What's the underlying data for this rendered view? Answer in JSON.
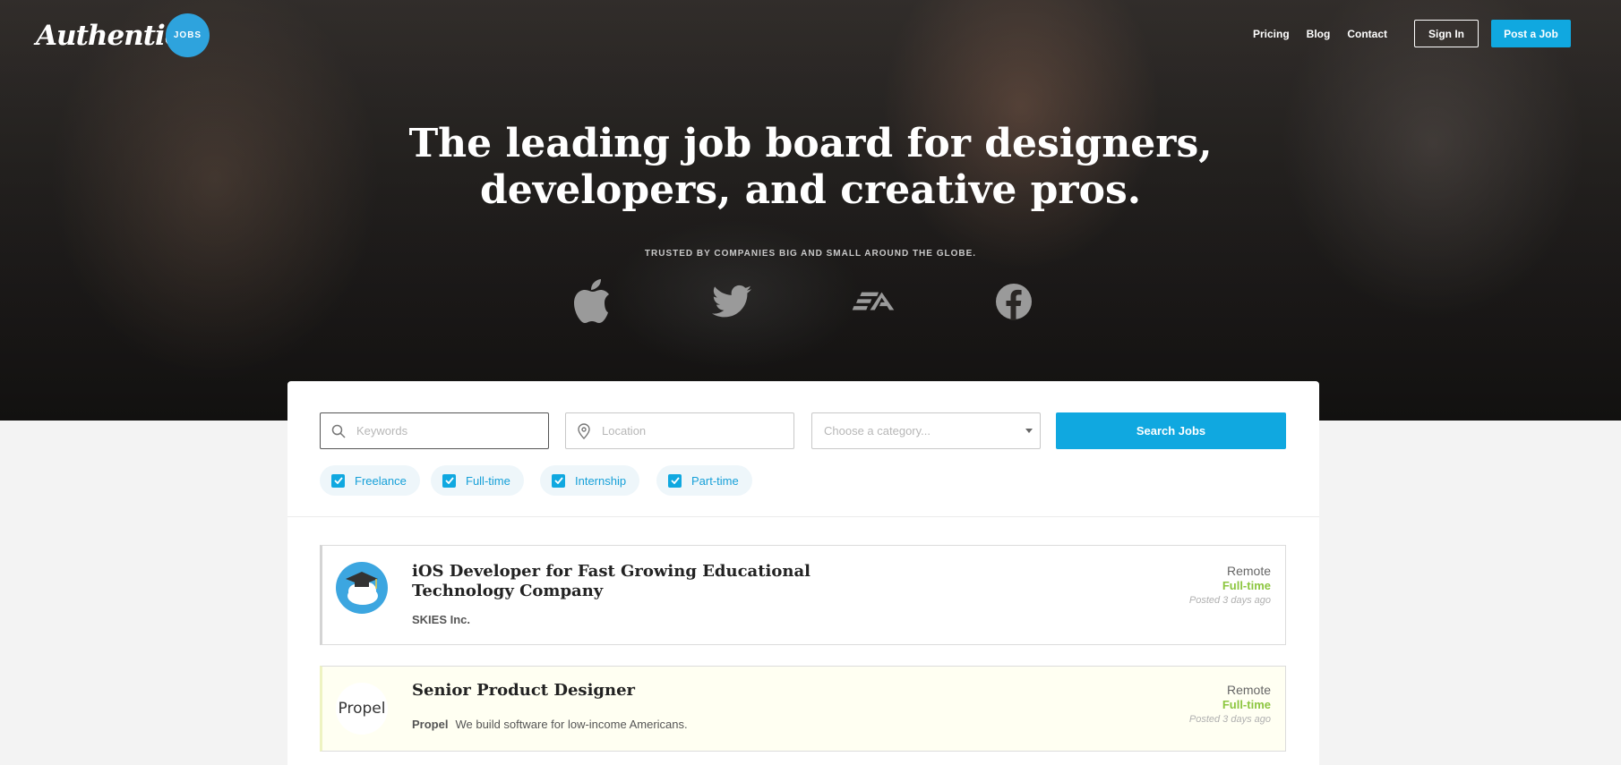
{
  "brand": {
    "logo_text": "Authentic",
    "badge": "JOBS"
  },
  "nav": {
    "links": [
      "Pricing",
      "Blog",
      "Contact"
    ],
    "sign_in": "Sign In",
    "post_job": "Post a Job"
  },
  "hero": {
    "headline_line1": "The leading job board for designers,",
    "headline_line2": "developers, and creative pros.",
    "trusted": "TRUSTED BY COMPANIES BIG AND SMALL AROUND THE GLOBE.",
    "brands": [
      "apple-icon",
      "twitter-icon",
      "ea-icon",
      "facebook-icon"
    ]
  },
  "search": {
    "keywords_placeholder": "Keywords",
    "location_placeholder": "Location",
    "category_placeholder": "Choose a category...",
    "button": "Search Jobs",
    "filters": [
      {
        "label": "Freelance",
        "checked": true
      },
      {
        "label": "Full-time",
        "checked": true
      },
      {
        "label": "Internship",
        "checked": true
      },
      {
        "label": "Part-time",
        "checked": true
      }
    ]
  },
  "jobs": [
    {
      "title": "iOS Developer for Fast Growing Educational Technology Company",
      "company": "SKIES Inc.",
      "description": "",
      "location": "Remote",
      "type": "Full-time",
      "posted": "Posted 3 days ago",
      "featured": false
    },
    {
      "title": "Senior Product Designer",
      "company": "Propel",
      "logo_text": "Propel",
      "description": "We build software for low-income Americans.",
      "location": "Remote",
      "type": "Full-time",
      "posted": "Posted 3 days ago",
      "featured": true
    }
  ],
  "colors": {
    "accent": "#10a8e0",
    "fulltime": "#8cc63f",
    "badge": "#2ea3dd"
  }
}
